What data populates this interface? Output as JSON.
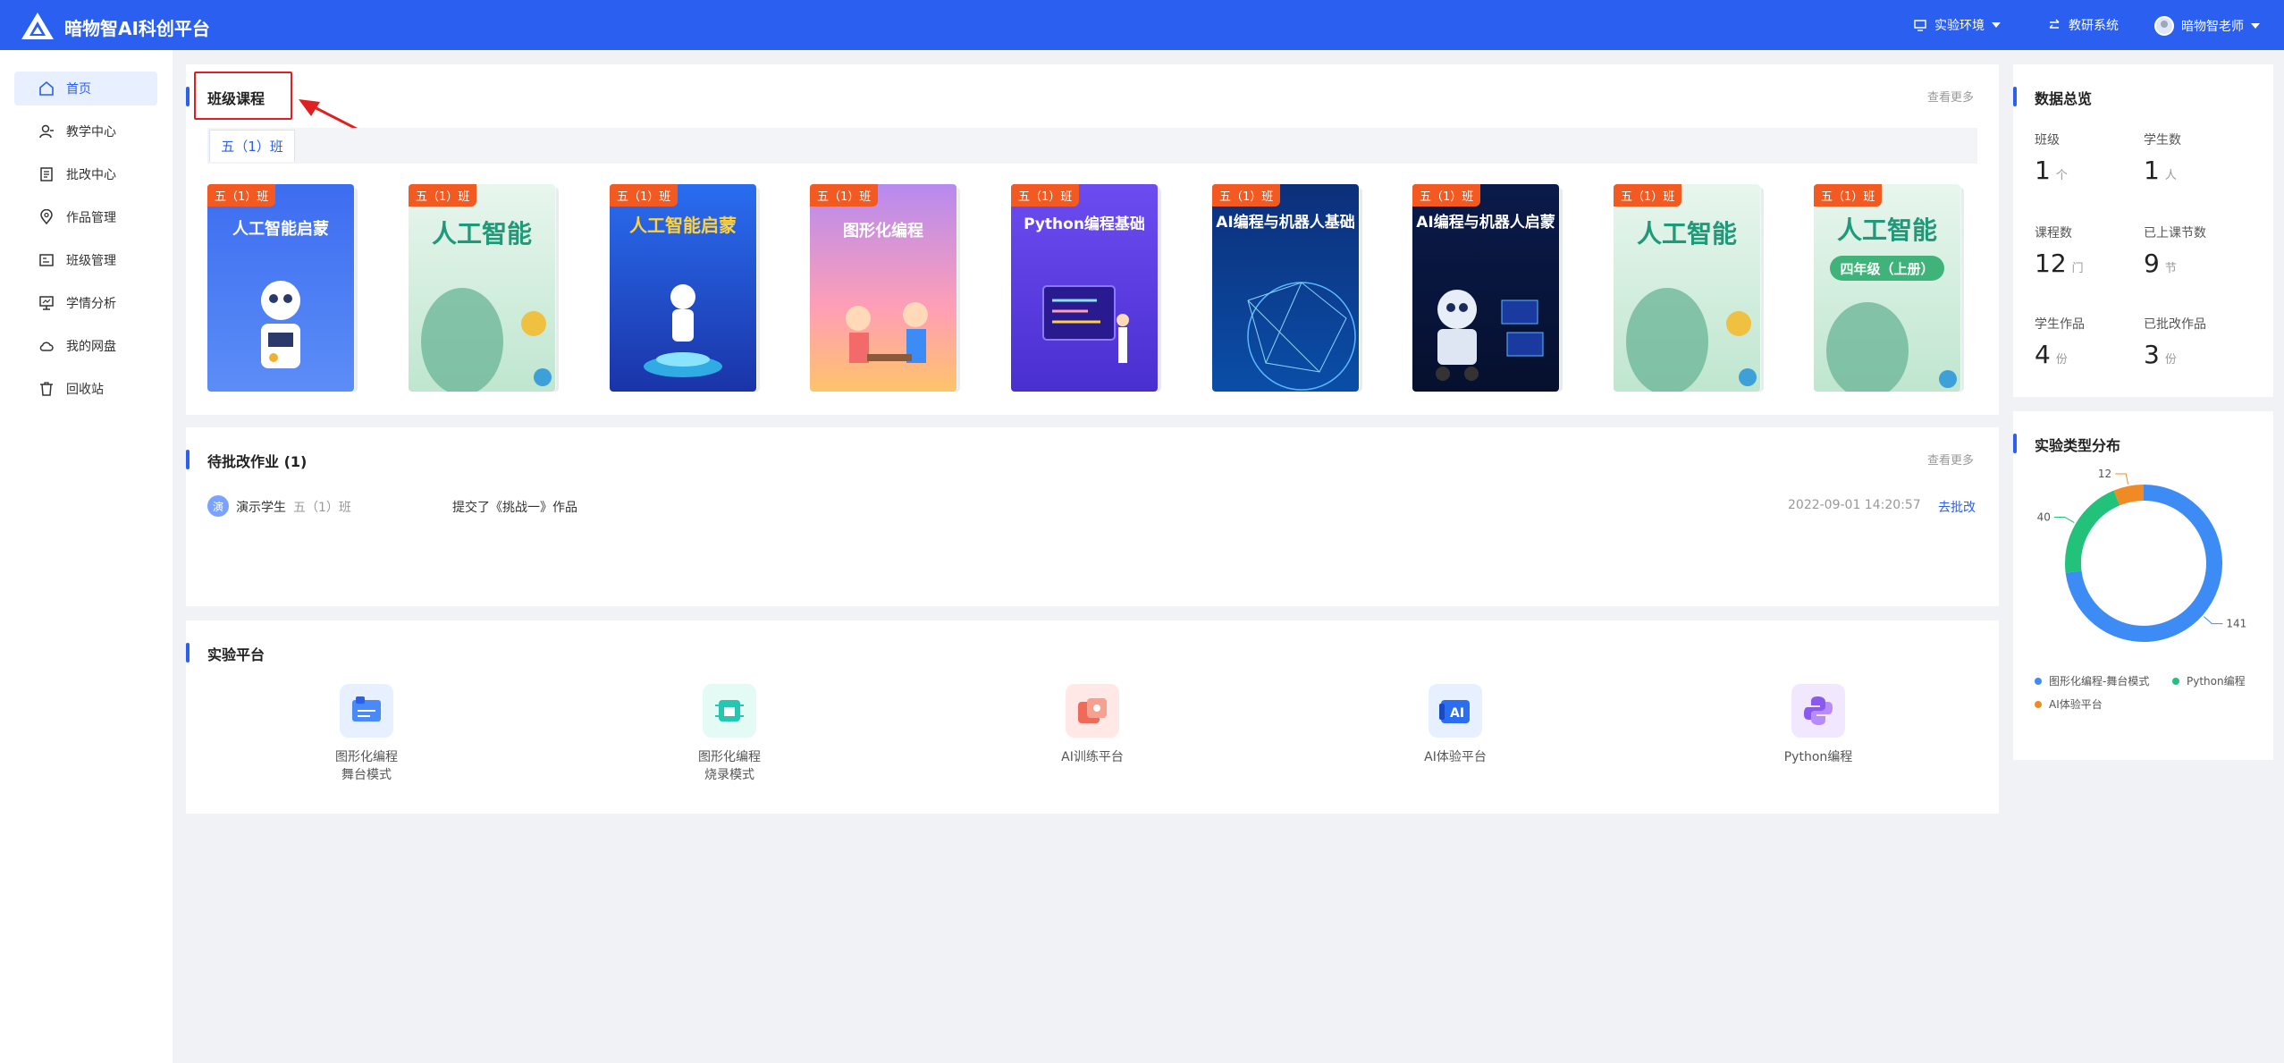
{
  "header": {
    "app_title": "暗物智AI科创平台",
    "env_label": "实验环境",
    "research_label": "教研系统",
    "user_name": "暗物智老师"
  },
  "sidebar": {
    "items": [
      {
        "label": "首页",
        "icon": "home-icon",
        "active": true
      },
      {
        "label": "教学中心",
        "icon": "teacher-icon",
        "active": false
      },
      {
        "label": "批改中心",
        "icon": "review-icon",
        "active": false
      },
      {
        "label": "作品管理",
        "icon": "location-pin-icon",
        "active": false
      },
      {
        "label": "班级管理",
        "icon": "class-card-icon",
        "active": false
      },
      {
        "label": "学情分析",
        "icon": "monitor-chart-icon",
        "active": false
      },
      {
        "label": "我的网盘",
        "icon": "cloud-icon",
        "active": false
      },
      {
        "label": "回收站",
        "icon": "trash-icon",
        "active": false
      }
    ]
  },
  "courses": {
    "title": "班级课程",
    "more": "查看更多",
    "class_tab": "五（1）班",
    "books": [
      {
        "badge": "五（1）班",
        "cover_text": "人工智能启蒙"
      },
      {
        "badge": "五（1）班",
        "cover_text": "人工智能"
      },
      {
        "badge": "五（1）班",
        "cover_text": "人工智能启蒙"
      },
      {
        "badge": "五（1）班",
        "cover_text": "图形化编程"
      },
      {
        "badge": "五（1）班",
        "cover_text": "Python编程基础"
      },
      {
        "badge": "五（1）班",
        "cover_text": "AI编程与机器人基础"
      },
      {
        "badge": "五（1）班",
        "cover_text": "AI编程与机器人启蒙"
      },
      {
        "badge": "五（1）班",
        "cover_text": "人工智能"
      },
      {
        "badge": "五（1）班",
        "cover_text": "人工智能",
        "sub_text": "四年级（上册）"
      }
    ]
  },
  "pending": {
    "title": "待批改作业 (1)",
    "more": "查看更多",
    "items": [
      {
        "avatar": "演",
        "student": "演示学生",
        "class": "五（1）班",
        "action": "提交了《挑战一》作品",
        "time": "2022-09-01 14:20:57",
        "link": "去批改"
      }
    ]
  },
  "platforms": {
    "title": "实验平台",
    "items": [
      {
        "line1": "图形化编程",
        "line2": "舞台模式",
        "icon": "stage-mode-icon"
      },
      {
        "line1": "图形化编程",
        "line2": "烧录模式",
        "icon": "burn-mode-icon"
      },
      {
        "line1": "AI训练平台",
        "line2": "",
        "icon": "ai-training-icon"
      },
      {
        "line1": "AI体验平台",
        "line2": "",
        "icon": "ai-experience-icon"
      },
      {
        "line1": "Python编程",
        "line2": "",
        "icon": "python-icon"
      }
    ]
  },
  "overview": {
    "title": "数据总览",
    "stats": [
      {
        "label": "班级",
        "value": "1",
        "unit": "个"
      },
      {
        "label": "学生数",
        "value": "1",
        "unit": "人"
      },
      {
        "label": "课程数",
        "value": "12",
        "unit": "门"
      },
      {
        "label": "已上课节数",
        "value": "9",
        "unit": "节"
      },
      {
        "label": "学生作品",
        "value": "4",
        "unit": "份"
      },
      {
        "label": "已批改作品",
        "value": "3",
        "unit": "份"
      }
    ]
  },
  "chart_data": {
    "type": "pie",
    "title": "实验类型分布",
    "series": [
      {
        "name": "图形化编程-舞台模式",
        "value": 141,
        "color": "#3d8bf5"
      },
      {
        "name": "Python编程",
        "value": 40,
        "color": "#22c27a"
      },
      {
        "name": "AI体验平台",
        "value": 12,
        "color": "#f08a24"
      }
    ],
    "legend_position": "bottom"
  }
}
